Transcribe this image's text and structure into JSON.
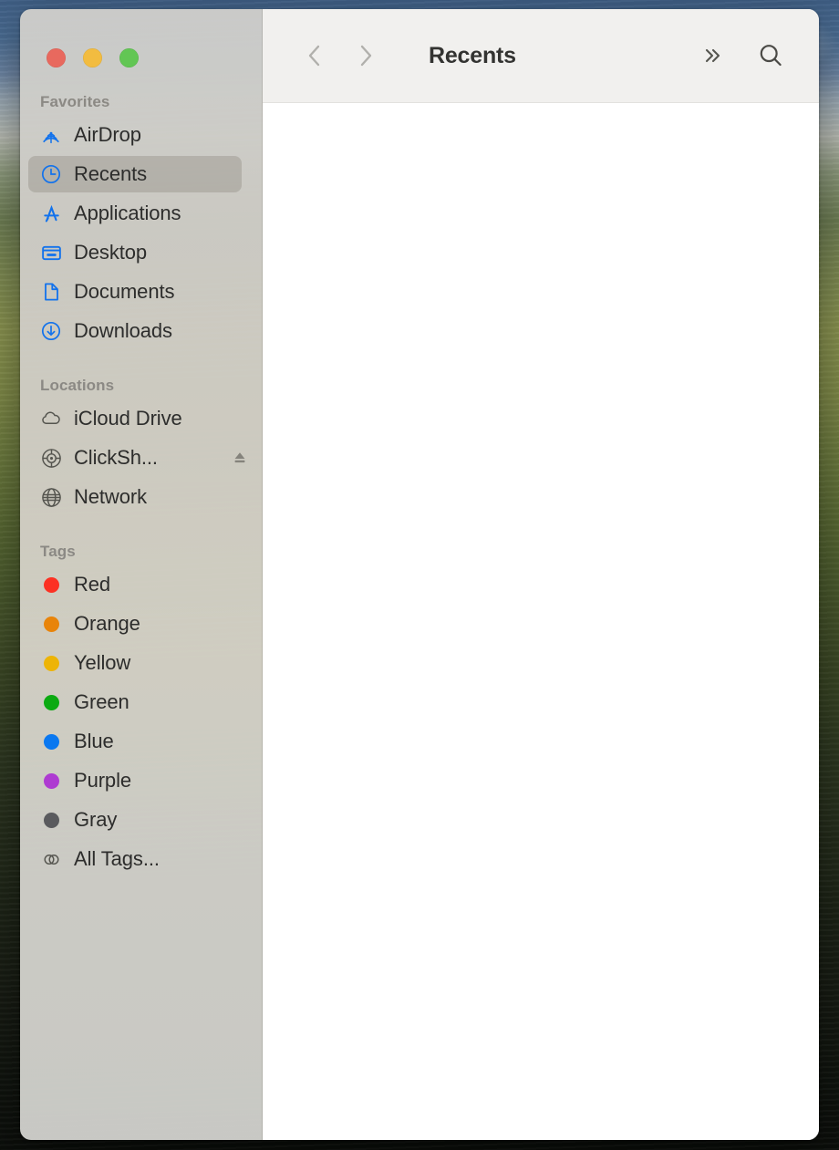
{
  "window": {
    "title": "Recents",
    "traffic_lights": [
      {
        "name": "close",
        "color": "#E8695E"
      },
      {
        "name": "minimize",
        "color": "#F2BC40"
      },
      {
        "name": "maximize",
        "color": "#62C654"
      }
    ]
  },
  "toolbar": {
    "back_icon": "chevron-left-icon",
    "forward_icon": "chevron-right-icon",
    "title": "Recents",
    "overflow_icon": "double-chevron-right-icon",
    "search_icon": "search-icon",
    "background": "#F1F0EE"
  },
  "sidebar": {
    "sections": [
      {
        "header": "Favorites",
        "items": [
          {
            "label": "AirDrop",
            "icon": "airdrop-icon",
            "icon_color": "#1272EC",
            "selected": false
          },
          {
            "label": "Recents",
            "icon": "clock-icon",
            "icon_color": "#1272EC",
            "selected": true
          },
          {
            "label": "Applications",
            "icon": "app-store-icon",
            "icon_color": "#1272EC",
            "selected": false
          },
          {
            "label": "Desktop",
            "icon": "display-icon",
            "icon_color": "#1272EC",
            "selected": false
          },
          {
            "label": "Documents",
            "icon": "document-icon",
            "icon_color": "#1272EC",
            "selected": false
          },
          {
            "label": "Downloads",
            "icon": "download-circle-icon",
            "icon_color": "#1272EC",
            "selected": false
          }
        ]
      },
      {
        "header": "Locations",
        "items": [
          {
            "label": "iCloud Drive",
            "icon": "cloud-icon",
            "icon_color": "#55554F",
            "selected": false
          },
          {
            "label": "ClickSh...",
            "icon": "optical-disc-icon",
            "icon_color": "#55554F",
            "selected": false,
            "eject": "eject-icon"
          },
          {
            "label": "Network",
            "icon": "globe-icon",
            "icon_color": "#55554F",
            "selected": false
          }
        ]
      },
      {
        "header": "Tags",
        "items": [
          {
            "label": "Red",
            "icon": "tag-dot-icon",
            "icon_color": "#FC3123",
            "selected": false
          },
          {
            "label": "Orange",
            "icon": "tag-dot-icon",
            "icon_color": "#E8840A",
            "selected": false
          },
          {
            "label": "Yellow",
            "icon": "tag-dot-icon",
            "icon_color": "#EDB406",
            "selected": false
          },
          {
            "label": "Green",
            "icon": "tag-dot-icon",
            "icon_color": "#0CAA12",
            "selected": false
          },
          {
            "label": "Blue",
            "icon": "tag-dot-icon",
            "icon_color": "#0A78F0",
            "selected": false
          },
          {
            "label": "Purple",
            "icon": "tag-dot-icon",
            "icon_color": "#AE3BD1",
            "selected": false
          },
          {
            "label": "Gray",
            "icon": "tag-dot-icon",
            "icon_color": "#5A5A5E",
            "selected": false
          },
          {
            "label": "All Tags...",
            "icon": "all-tags-icon",
            "icon_color": "#55554F",
            "selected": false
          }
        ]
      }
    ]
  },
  "content": {
    "items": [],
    "background": "#FFFFFF"
  }
}
